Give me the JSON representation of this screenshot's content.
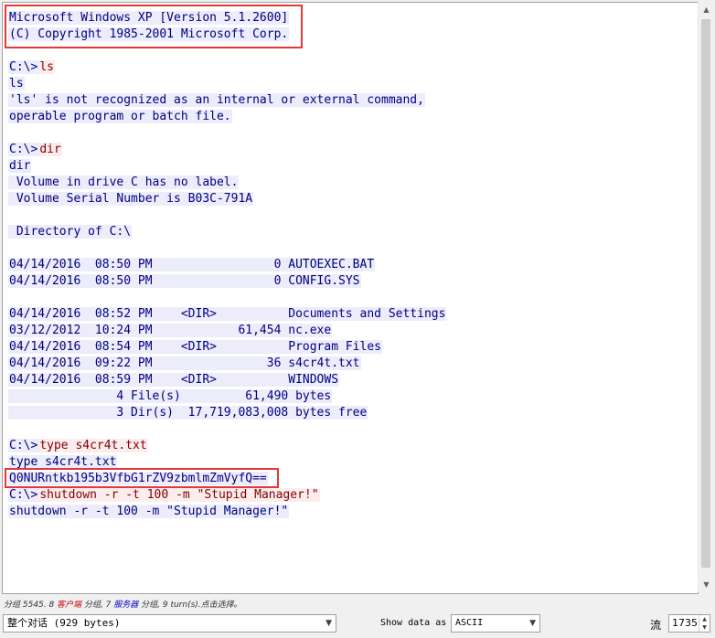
{
  "stream_lines": [
    {
      "dir": "server",
      "text": "Microsoft Windows XP [Version 5.1.2600]"
    },
    {
      "dir": "server",
      "text": "(C) Copyright 1985-2001 Microsoft Corp."
    },
    {
      "dir": "blank",
      "text": ""
    },
    {
      "dir": "server",
      "text": "C:\\>",
      "client_text": "ls"
    },
    {
      "dir": "server",
      "text": "ls"
    },
    {
      "dir": "server",
      "text": "'ls' is not recognized as an internal or external command,"
    },
    {
      "dir": "server",
      "text": "operable program or batch file."
    },
    {
      "dir": "blank",
      "text": ""
    },
    {
      "dir": "server",
      "text": "C:\\>",
      "client_text": "dir"
    },
    {
      "dir": "server",
      "text": "dir"
    },
    {
      "dir": "server",
      "text": " Volume in drive C has no label."
    },
    {
      "dir": "server",
      "text": " Volume Serial Number is B03C-791A"
    },
    {
      "dir": "blank",
      "text": ""
    },
    {
      "dir": "server",
      "text": " Directory of C:\\"
    },
    {
      "dir": "blank",
      "text": ""
    },
    {
      "dir": "server",
      "text": "04/14/2016  08:50 PM                 0 AUTOEXEC.BAT"
    },
    {
      "dir": "server",
      "text": "04/14/2016  08:50 PM                 0 CONFIG.SYS"
    },
    {
      "dir": "blank",
      "text": ""
    },
    {
      "dir": "server",
      "text": "04/14/2016  08:52 PM    <DIR>          Documents and Settings"
    },
    {
      "dir": "server",
      "text": "03/12/2012  10:24 PM            61,454 nc.exe"
    },
    {
      "dir": "server",
      "text": "04/14/2016  08:54 PM    <DIR>          Program Files"
    },
    {
      "dir": "server",
      "text": "04/14/2016  09:22 PM                36 s4cr4t.txt"
    },
    {
      "dir": "server",
      "text": "04/14/2016  08:59 PM    <DIR>          WINDOWS"
    },
    {
      "dir": "server",
      "text": "               4 File(s)         61,490 bytes"
    },
    {
      "dir": "server",
      "text": "               3 Dir(s)  17,719,083,008 bytes free"
    },
    {
      "dir": "blank",
      "text": ""
    },
    {
      "dir": "server",
      "text": "C:\\>",
      "client_text": "type s4cr4t.txt"
    },
    {
      "dir": "server",
      "text": "type s4cr4t.txt"
    },
    {
      "dir": "server",
      "text": "Q0NURntkb195b3VfbG1rZV9zbmlmZmVyfQ=="
    },
    {
      "dir": "server",
      "text": "C:\\>",
      "client_text": "shutdown -r -t 100 -m \"Stupid Manager!\""
    },
    {
      "dir": "server",
      "text": "shutdown -r -t 100 -m \"Stupid Manager!\""
    }
  ],
  "status": {
    "prefix": "分组 5545. 8 ",
    "client_label": "客户端",
    "mid": " 分组, 7 ",
    "server_label": "服务器",
    "suffix": " 分组, 9 turn(s).点击选择。"
  },
  "controls": {
    "conversation_value": "整个对话 (929 bytes)",
    "show_data_label": "Show data as",
    "show_data_value": "ASCII",
    "stream_label": "流",
    "stream_value": "1735"
  },
  "colors": {
    "client_text": "#800000",
    "client_bg": "#fbeded",
    "server_text": "#000080",
    "server_bg": "#ececfa",
    "highlight_box": "#e53935"
  }
}
